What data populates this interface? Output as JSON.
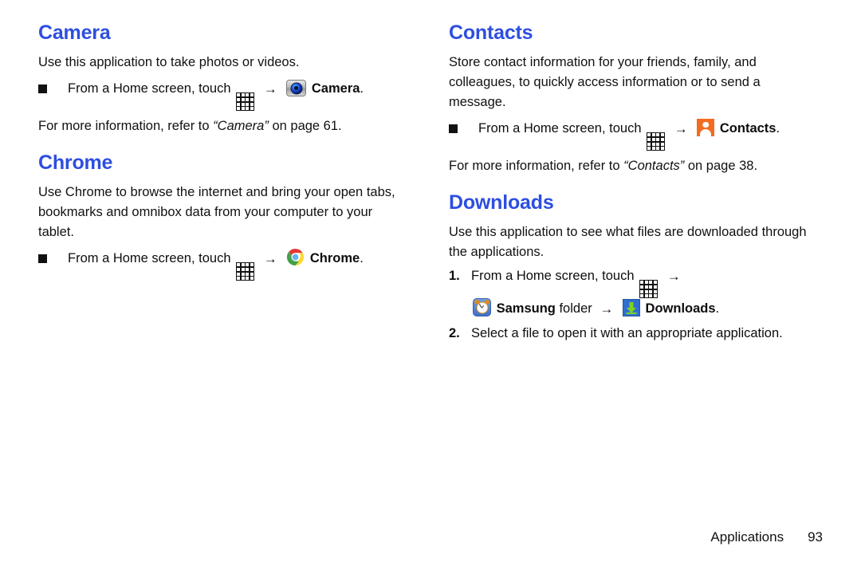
{
  "document": {
    "footer": {
      "section_label": "Applications",
      "page_number": "93"
    },
    "heading_color": "#2d4ee0",
    "text_color": "#111111"
  },
  "left_column": {
    "sections": [
      {
        "id": "camera",
        "heading": "Camera",
        "intro": "Use this application to take photos or videos.",
        "bullets": [
          {
            "prefix": "From a Home screen, touch",
            "arrow": "→",
            "icons": [
              "apps-grid-icon",
              "camera-icon"
            ],
            "target": "Camera",
            "suffix": "."
          }
        ],
        "crossref": {
          "lead": "For more information, refer to",
          "title": "“Camera”",
          "tail": "on page 61."
        }
      },
      {
        "id": "chrome",
        "heading": "Chrome",
        "intro": "Use Chrome to browse the internet and bring your open tabs, bookmarks and omnibox data from your computer to your tablet.",
        "bullets": [
          {
            "prefix": "From a Home screen, touch",
            "arrow": "→",
            "icons": [
              "apps-grid-icon",
              "chrome-icon"
            ],
            "target": "Chrome",
            "suffix": "."
          }
        ]
      }
    ]
  },
  "right_column": {
    "sections": [
      {
        "id": "contacts",
        "heading": "Contacts",
        "intro": "Store contact information for your friends, family, and colleagues, to quickly access information or to send a message.",
        "bullets": [
          {
            "prefix": "From a Home screen, touch",
            "arrow": "→",
            "icons": [
              "apps-grid-icon",
              "contacts-icon"
            ],
            "target": "Contacts",
            "suffix": "."
          }
        ],
        "crossref": {
          "lead": "For more information, refer to",
          "title": "“Contacts”",
          "tail": "on page 38."
        }
      },
      {
        "id": "downloads",
        "heading": "Downloads",
        "intro": "Use this application to see what files are downloaded through the applications.",
        "steps": [
          {
            "number": "1.",
            "line1_prefix": "From a Home screen, touch",
            "line1_arrow": "→",
            "line2_folder": "Samsung",
            "line2_folder_word": "folder",
            "line2_arrow": "→",
            "line2_target": "Downloads",
            "line2_suffix": "."
          },
          {
            "number": "2.",
            "text": "Select a file to open it with an appropriate application."
          }
        ]
      }
    ]
  }
}
